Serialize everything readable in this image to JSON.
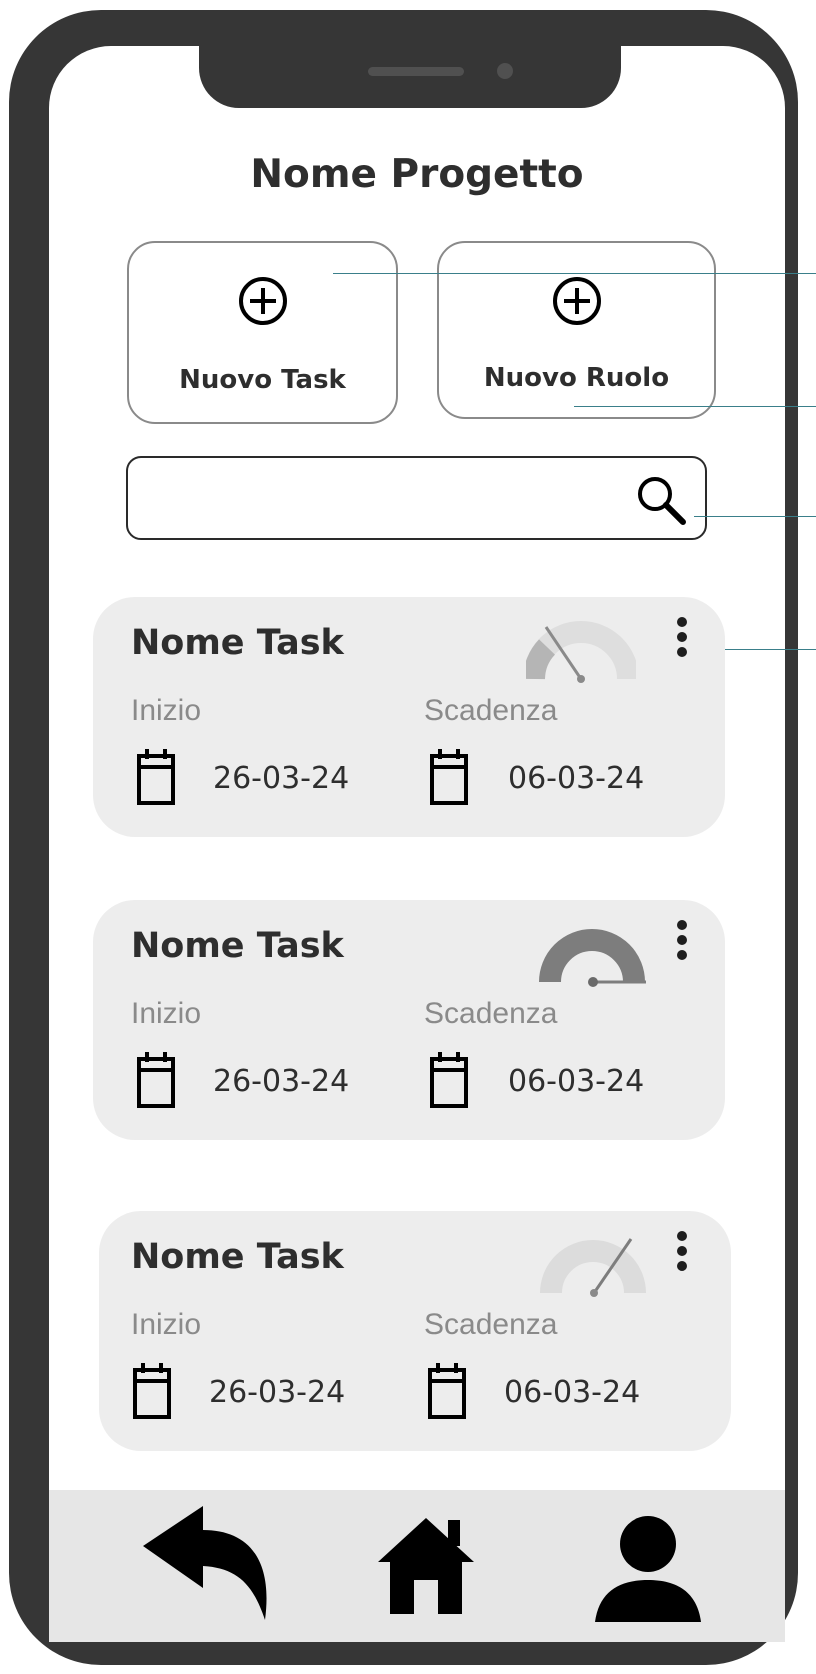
{
  "header": {
    "title": "Nome Progetto"
  },
  "actions": [
    {
      "label": "Nuovo Task",
      "icon": "plus-circle-icon"
    },
    {
      "label": "Nuovo Ruolo",
      "icon": "plus-circle-icon"
    }
  ],
  "search": {
    "value": "",
    "icon": "search-icon"
  },
  "tasks": [
    {
      "name": "Nome Task",
      "start_label": "Inizio",
      "start_date": "26-03-24",
      "due_label": "Scadenza",
      "due_date": "06-03-24",
      "progress_icon": "gauge-low-icon",
      "progress": 0.15
    },
    {
      "name": "Nome Task",
      "start_label": "Inizio",
      "start_date": "26-03-24",
      "due_label": "Scadenza",
      "due_date": "06-03-24",
      "progress_icon": "gauge-full-icon",
      "progress": 1.0
    },
    {
      "name": "Nome Task",
      "start_label": "Inizio",
      "start_date": "26-03-24",
      "due_label": "Scadenza",
      "due_date": "06-03-24",
      "progress_icon": "gauge-high-icon",
      "progress": 0.75
    }
  ],
  "bottom_nav": [
    {
      "icon": "back-arrow-icon"
    },
    {
      "icon": "home-icon"
    },
    {
      "icon": "user-icon"
    }
  ],
  "colors": {
    "phone_frame": "#363636",
    "card_bg": "#ededed",
    "nav_bg": "#e6e6e6",
    "callout_line": "#3a7f8a"
  }
}
